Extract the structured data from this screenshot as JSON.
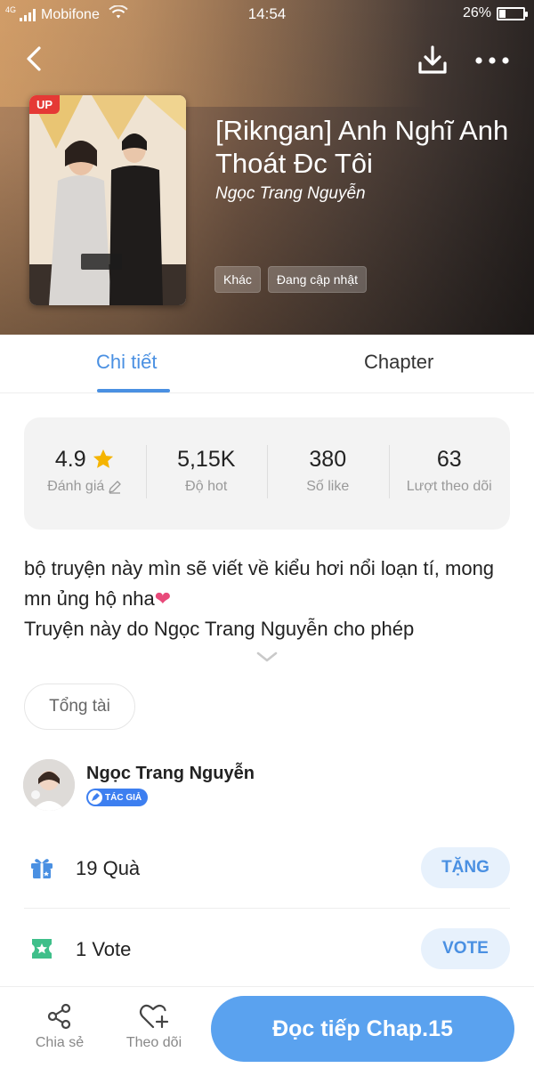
{
  "status_bar": {
    "network_type": "4G",
    "carrier": "Mobifone",
    "time": "14:54",
    "battery": "26%"
  },
  "header": {
    "back_icon": "chevron-left-icon",
    "download_icon": "download-icon",
    "more_icon": "more-horizontal-icon"
  },
  "book": {
    "badge": "UP",
    "title": "[Rikngan] Anh Nghĩ Anh Thoát Đc Tôi",
    "author": "Ngọc Trang Nguyễn",
    "tags": [
      "Khác",
      "Đang cập nhật"
    ]
  },
  "tabs": {
    "detail": "Chi tiết",
    "chapter": "Chapter",
    "active": "detail"
  },
  "stats": {
    "rating": {
      "value": "4.9",
      "label": "Đánh giá"
    },
    "hot": {
      "value": "5,15K",
      "label": "Độ hot"
    },
    "likes": {
      "value": "380",
      "label": "Số like"
    },
    "follows": {
      "value": "63",
      "label": "Lượt theo dõi"
    }
  },
  "description": {
    "line1": "bộ truyện này mìn sẽ viết về kiểu hơi nổi loạn tí, mong mn ủng hộ nha",
    "line2": "Truyện này do Ngọc Trang Nguyễn cho phép"
  },
  "genre": "Tổng tài",
  "author_block": {
    "name": "Ngọc Trang Nguyễn",
    "badge": "TÁC GIẢ"
  },
  "gift": {
    "count_text": "19 Quà",
    "button": "TẶNG"
  },
  "vote": {
    "count_text": "1 Vote",
    "button": "VOTE"
  },
  "bottom_bar": {
    "share": "Chia sẻ",
    "follow": "Theo dõi",
    "read": "Đọc tiếp Chap.15"
  },
  "colors": {
    "accent": "#4a90e2",
    "read_button": "#5aa2ef",
    "up_badge": "#e53935",
    "star": "#f5b400",
    "gift_icon": "#4a90e2",
    "vote_icon": "#3fbf8a",
    "heart": "#e84a7a"
  }
}
